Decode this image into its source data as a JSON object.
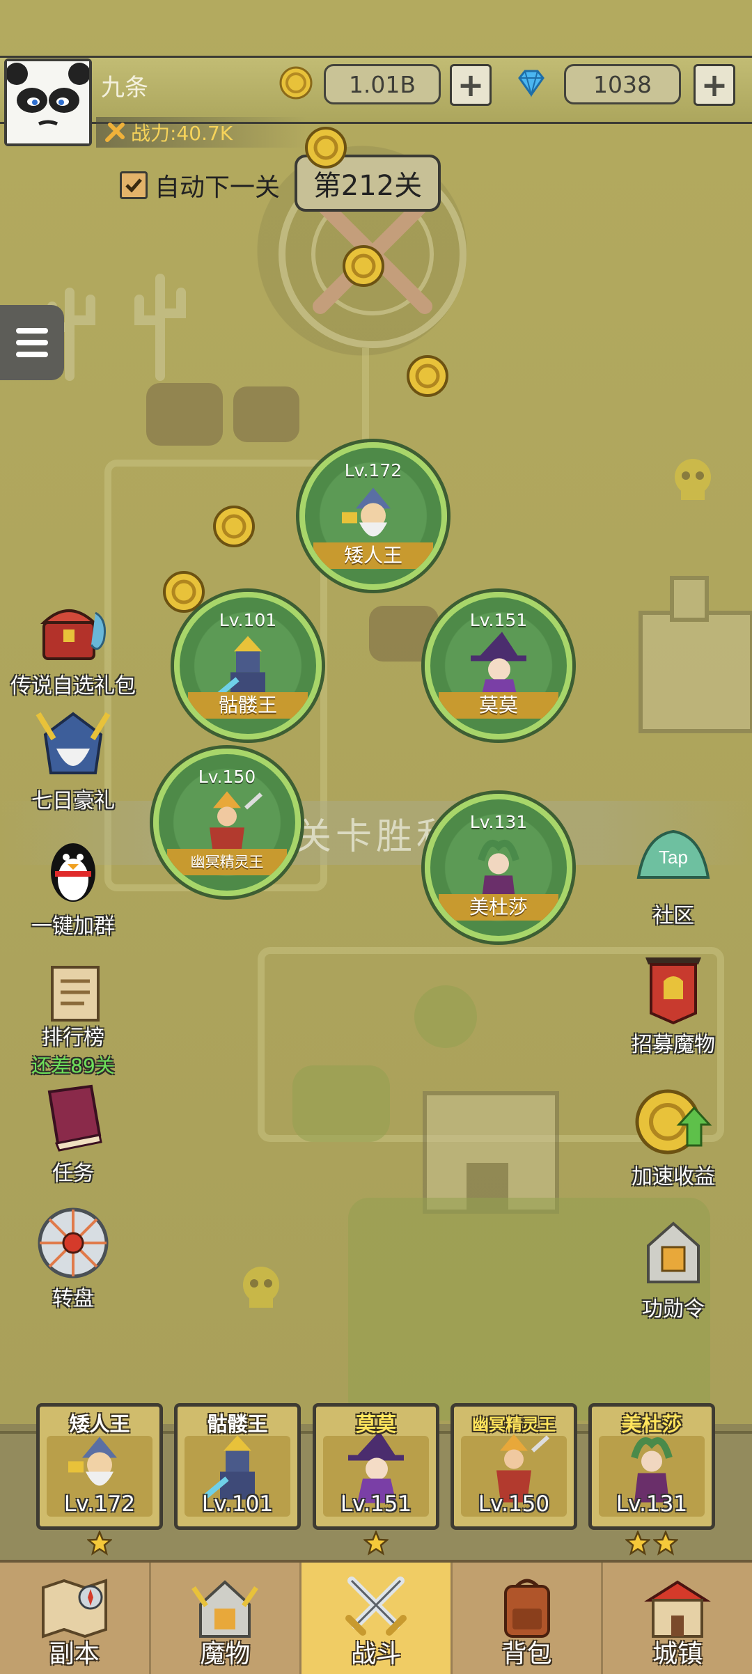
{
  "player": {
    "name": "九条",
    "power": "战力:40.7K",
    "gold": "1.01B",
    "gems": "1038"
  },
  "stage": {
    "auto_next_label": "自动下一关",
    "auto_next_checked": true,
    "current": "第212关"
  },
  "victory_text": "关卡胜利",
  "heroes_on_map": [
    {
      "level": "Lv.172",
      "name": "矮人王"
    },
    {
      "level": "Lv.101",
      "name": "骷髅王"
    },
    {
      "level": "Lv.151",
      "name": "莫莫"
    },
    {
      "level": "Lv.150",
      "name": "幽冥精灵王"
    },
    {
      "level": "Lv.131",
      "name": "美杜莎"
    }
  ],
  "left_buttons": [
    {
      "label": "传说自选礼包",
      "icon": "treasure-chest-icon"
    },
    {
      "label": "七日豪礼",
      "icon": "knight-helmet-icon"
    },
    {
      "label": "一键加群",
      "icon": "penguin-icon"
    },
    {
      "label": "排行榜",
      "sub": "还差89关",
      "icon": "scroll-icon"
    },
    {
      "label": "任务",
      "icon": "book-icon"
    },
    {
      "label": "转盘",
      "icon": "wheel-icon"
    }
  ],
  "right_buttons": [
    {
      "label": "社区",
      "icon": "tap-community-icon",
      "badge": "Tap"
    },
    {
      "label": "招募魔物",
      "icon": "banner-icon"
    },
    {
      "label": "加速收益",
      "icon": "coin-boost-icon"
    },
    {
      "label": "功勋令",
      "icon": "helmet-medal-icon"
    }
  ],
  "team": [
    {
      "name": "矮人王",
      "level": "Lv.172",
      "stars": 1,
      "name_color": "white"
    },
    {
      "name": "骷髅王",
      "level": "Lv.101",
      "stars": 0,
      "name_color": "white"
    },
    {
      "name": "莫莫",
      "level": "Lv.151",
      "stars": 1,
      "name_color": "gold"
    },
    {
      "name": "幽冥精灵王",
      "level": "Lv.150",
      "stars": 0,
      "name_color": "gold"
    },
    {
      "name": "美杜莎",
      "level": "Lv.131",
      "stars": 2,
      "name_color": "gold"
    }
  ],
  "nav": [
    {
      "label": "副本",
      "icon": "map-compass-icon"
    },
    {
      "label": "魔物",
      "icon": "monster-helmet-icon"
    },
    {
      "label": "战斗",
      "icon": "crossed-swords-icon",
      "active": true
    },
    {
      "label": "背包",
      "icon": "backpack-icon"
    },
    {
      "label": "城镇",
      "icon": "shop-building-icon"
    }
  ],
  "colors": {
    "map_bg": "#b6ad62",
    "hero_ring": "#a8d66a",
    "name_ribbon": "#c89a2f",
    "active_tab": "#f0cc64",
    "power_text": "#f6d35a",
    "rank_sub": "#6ee05a"
  }
}
